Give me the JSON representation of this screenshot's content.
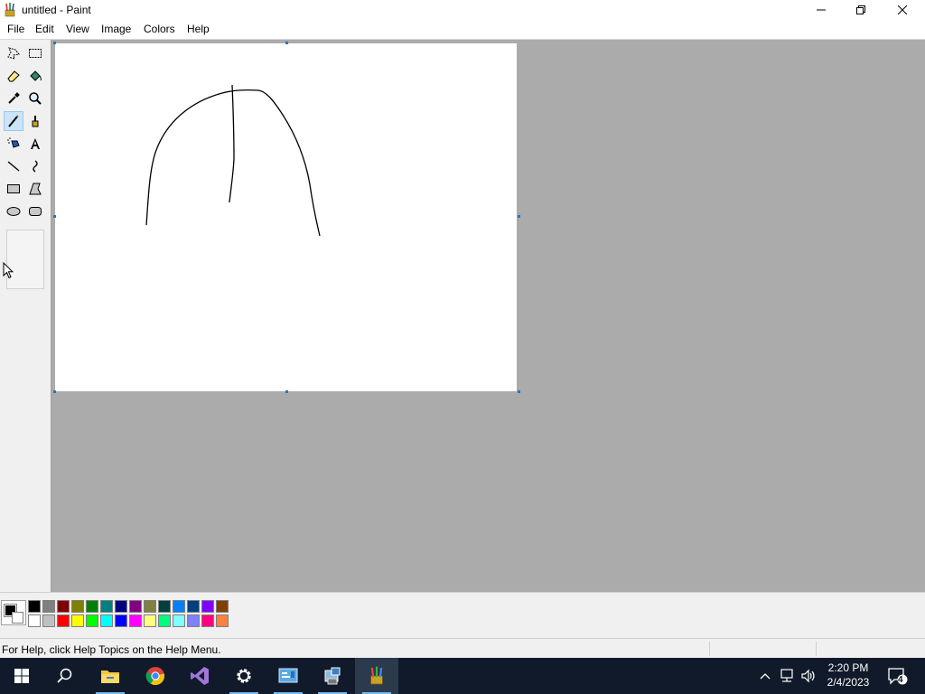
{
  "window": {
    "title": "untitled - Paint",
    "app_icon": "paint-brushes-icon",
    "controls": [
      "minimize-icon",
      "restore-icon",
      "close-icon"
    ]
  },
  "menu": {
    "items": [
      "File",
      "Edit",
      "View",
      "Image",
      "Colors",
      "Help"
    ]
  },
  "toolbox": {
    "tools": [
      {
        "name": "free-form-select",
        "icon": "free-form-select-icon"
      },
      {
        "name": "select",
        "icon": "rect-select-icon"
      },
      {
        "name": "eraser",
        "icon": "eraser-icon"
      },
      {
        "name": "fill",
        "icon": "fill-bucket-icon"
      },
      {
        "name": "pick-color",
        "icon": "eyedropper-icon"
      },
      {
        "name": "magnifier",
        "icon": "magnifier-icon"
      },
      {
        "name": "pencil",
        "icon": "pencil-icon",
        "selected": true
      },
      {
        "name": "brush",
        "icon": "brush-icon"
      },
      {
        "name": "airbrush",
        "icon": "airbrush-icon"
      },
      {
        "name": "text",
        "icon": "text-icon",
        "glyph": "A"
      },
      {
        "name": "line",
        "icon": "line-icon"
      },
      {
        "name": "curve",
        "icon": "curve-icon"
      },
      {
        "name": "rectangle",
        "icon": "rectangle-icon"
      },
      {
        "name": "polygon",
        "icon": "polygon-icon"
      },
      {
        "name": "ellipse",
        "icon": "ellipse-icon"
      },
      {
        "name": "rounded-rectangle",
        "icon": "rounded-rectangle-icon"
      }
    ]
  },
  "palette": {
    "foreground": "#000000",
    "background": "#ffffff",
    "top_row": [
      "#000000",
      "#808080",
      "#800000",
      "#808000",
      "#008000",
      "#008080",
      "#000080",
      "#800080",
      "#808040",
      "#004040",
      "#0080ff",
      "#004080",
      "#8000ff",
      "#804000"
    ],
    "bottom_row": [
      "#ffffff",
      "#c0c0c0",
      "#ff0000",
      "#ffff00",
      "#00ff00",
      "#00ffff",
      "#0000ff",
      "#ff00ff",
      "#ffff80",
      "#00ff80",
      "#80ffff",
      "#8080ff",
      "#ff0080",
      "#ff8040"
    ]
  },
  "status": {
    "help_text": "For Help, click Help Topics on the Help Menu."
  },
  "taskbar": {
    "items": [
      "windows-start-icon",
      "search-icon",
      "file-explorer-icon",
      "chrome-icon",
      "visual-studio-icon",
      "settings-gear-icon",
      "control-panel-icon",
      "device-manager-icon",
      "paint-icon"
    ],
    "tray_icons": [
      "chevron-up-icon",
      "network-icon",
      "volume-icon"
    ],
    "time": "2:20 PM",
    "date": "2/4/2023",
    "notification_count": "4"
  }
}
